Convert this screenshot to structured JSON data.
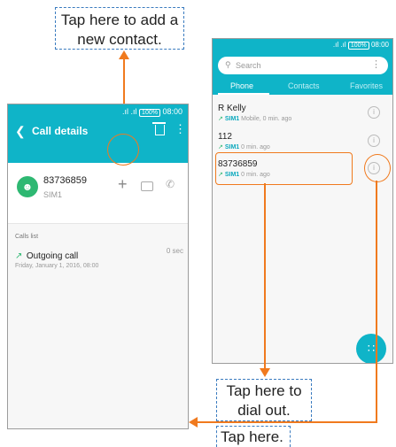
{
  "callouts": {
    "add_contact": "Tap here to add a new contact.",
    "dial_out": "Tap here to dial out.",
    "tap_here": "Tap here."
  },
  "left_phone": {
    "status_time": "08:00",
    "status_battery": "100%",
    "title": "Call details",
    "contact_number": "83736859",
    "contact_sim": "SIM1",
    "calls_list_label": "Calls list",
    "call_type": "Outgoing call",
    "call_date": "Friday, January 1, 2016, 08:00",
    "call_duration": "0 sec"
  },
  "right_phone": {
    "status_time": "08:00",
    "status_battery": "100%",
    "search_placeholder": "Search",
    "tabs": [
      "Phone",
      "Contacts",
      "Favorites"
    ],
    "calls": [
      {
        "name": "R Kelly",
        "sim": "SIM1",
        "detail": "Mobile, 0 min. ago"
      },
      {
        "name": "112",
        "sim": "SIM1",
        "detail": "0 min. ago"
      },
      {
        "name": "83736859",
        "sim": "SIM1",
        "detail": "0 min. ago"
      }
    ]
  },
  "colors": {
    "accent": "#0fb4c8",
    "highlight": "#f07a1e",
    "callout_border": "#3a7bbf",
    "avatar": "#2eb872"
  }
}
